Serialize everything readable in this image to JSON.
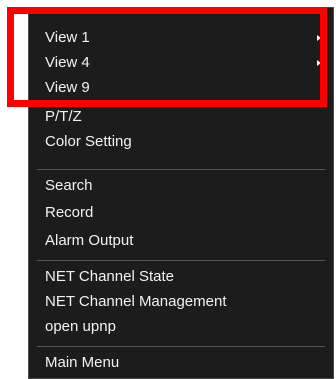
{
  "menu": {
    "items": [
      {
        "label": "View 1",
        "submenu": true
      },
      {
        "label": "View 4",
        "submenu": true
      },
      {
        "label": "View 9",
        "submenu": false
      },
      {
        "label": "P/T/Z",
        "submenu": false
      },
      {
        "label": "Color Setting",
        "submenu": false
      },
      {
        "label": "Search",
        "submenu": false
      },
      {
        "label": "Record",
        "submenu": false
      },
      {
        "label": "Alarm Output",
        "submenu": false
      },
      {
        "label": "NET Channel State",
        "submenu": false
      },
      {
        "label": "NET Channel Management",
        "submenu": false
      },
      {
        "label": "open upnp",
        "submenu": false
      },
      {
        "label": "Main Menu",
        "submenu": false
      }
    ]
  },
  "colors": {
    "menu_background": "#1c1c1c",
    "menu_text": "#f2f2f2",
    "highlight_border": "#ff0000"
  }
}
